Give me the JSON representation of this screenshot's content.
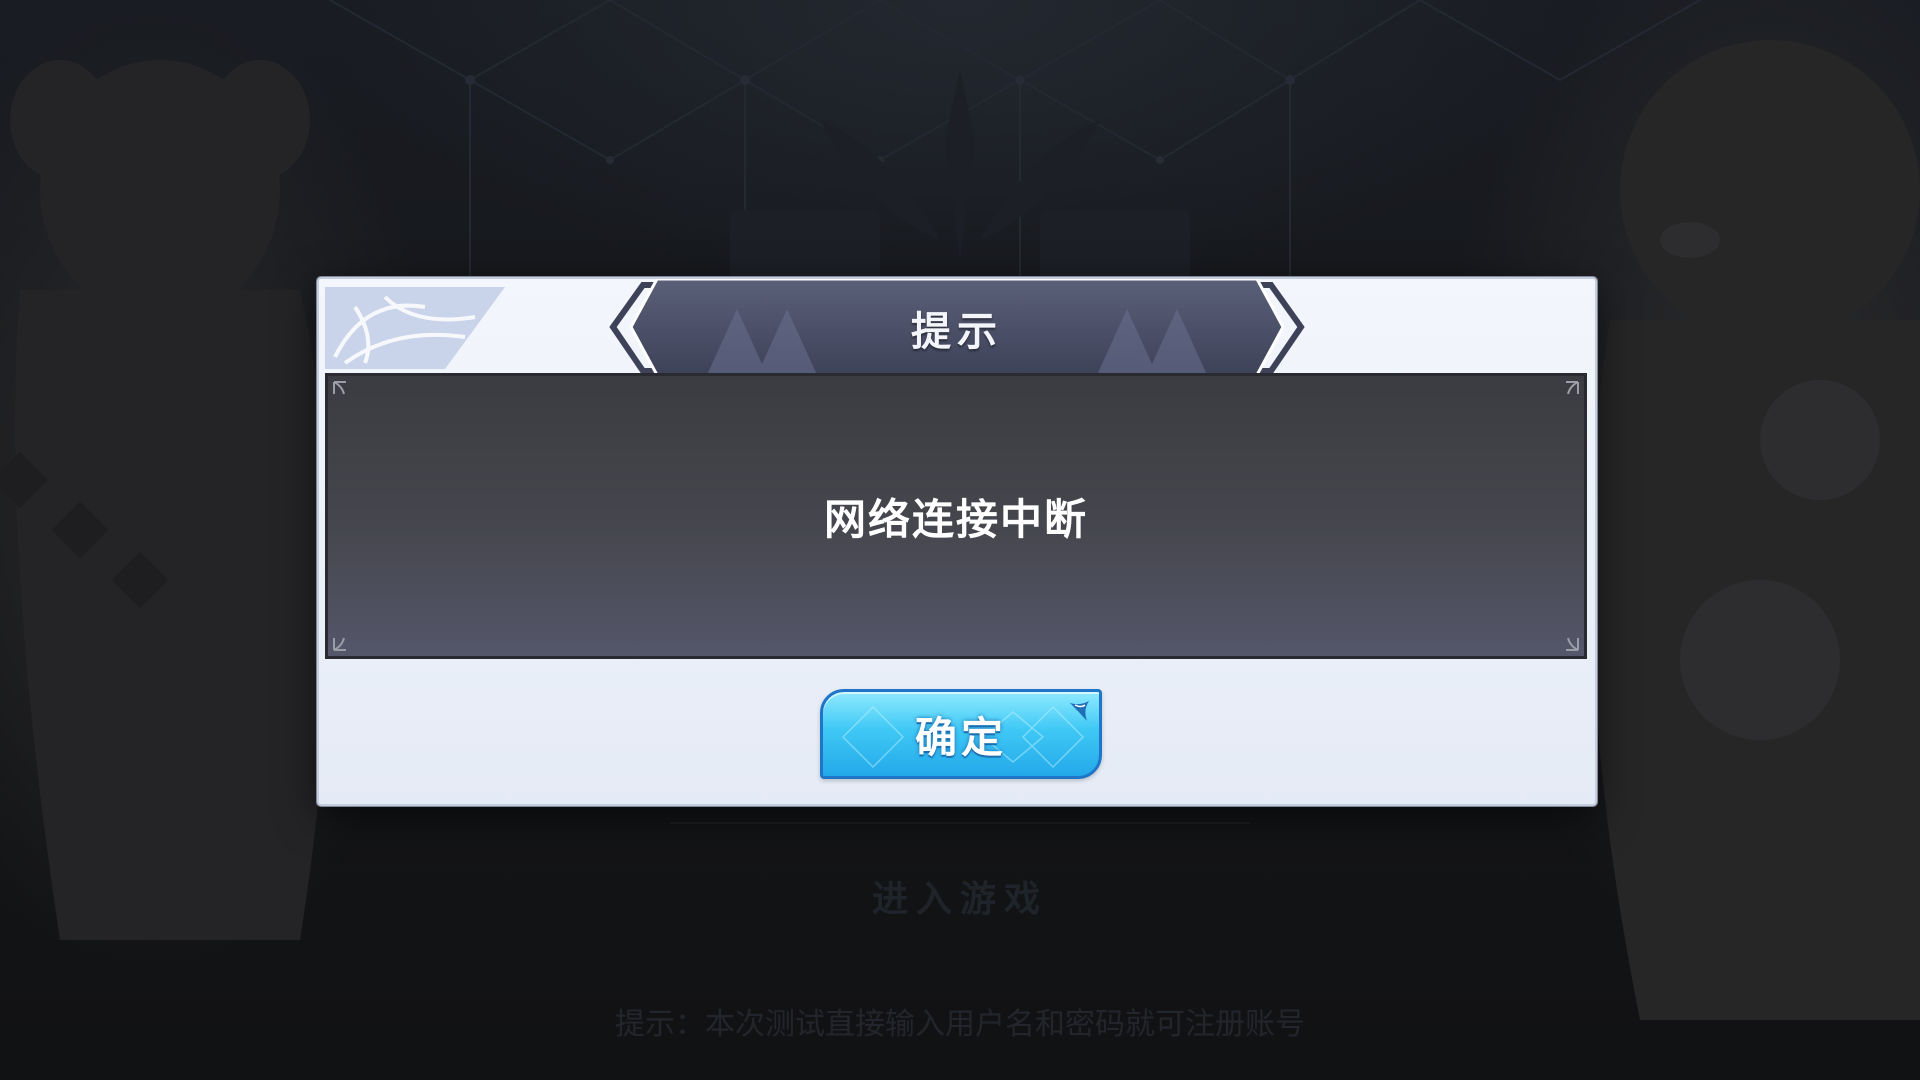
{
  "background": {
    "enter_game_label": "进入游戏",
    "hint_text": "提示：本次测试直接输入用户名和密码就可注册账号"
  },
  "dialog": {
    "title": "提示",
    "message": "网络连接中断",
    "confirm_label": "确定"
  },
  "colors": {
    "dialog_bg": "#eef2fa",
    "panel_bg": "#46474e",
    "title_plate": "#4a5068",
    "button": "#3fc8f5"
  },
  "icons": {
    "title_plate": "ornamental-banner",
    "corner": "filigree-corner-icon",
    "sparkle": "sparkle-icon"
  }
}
